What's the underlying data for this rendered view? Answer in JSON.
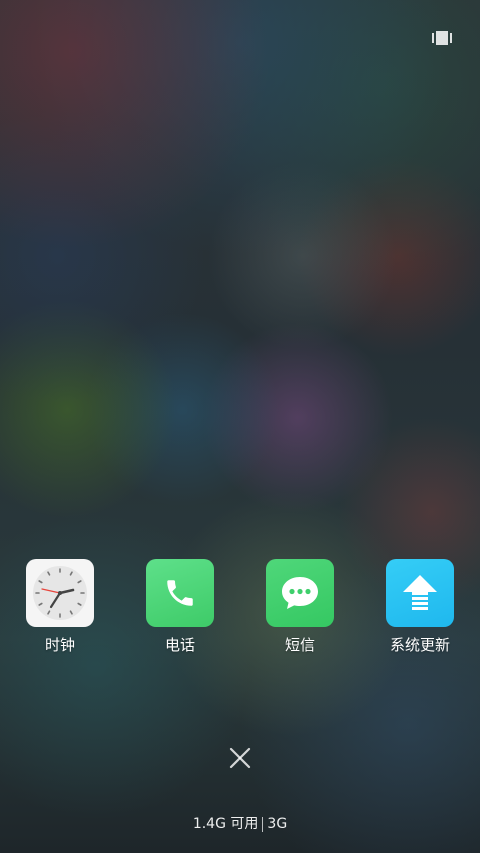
{
  "apps": [
    {
      "label": "时钟",
      "icon": "clock-icon",
      "color": "#f5f5f5"
    },
    {
      "label": "电话",
      "icon": "phone-icon",
      "color": "#4cd473"
    },
    {
      "label": "短信",
      "icon": "message-icon",
      "color": "#3fcf6c"
    },
    {
      "label": "系统更新",
      "icon": "system-update-icon",
      "color": "#27c2f2"
    }
  ],
  "close": {
    "icon": "close-icon"
  },
  "status": {
    "memory_available": "1.4G 可用",
    "network": "3G"
  },
  "recents_toggle": {
    "icon": "recents-icon"
  }
}
